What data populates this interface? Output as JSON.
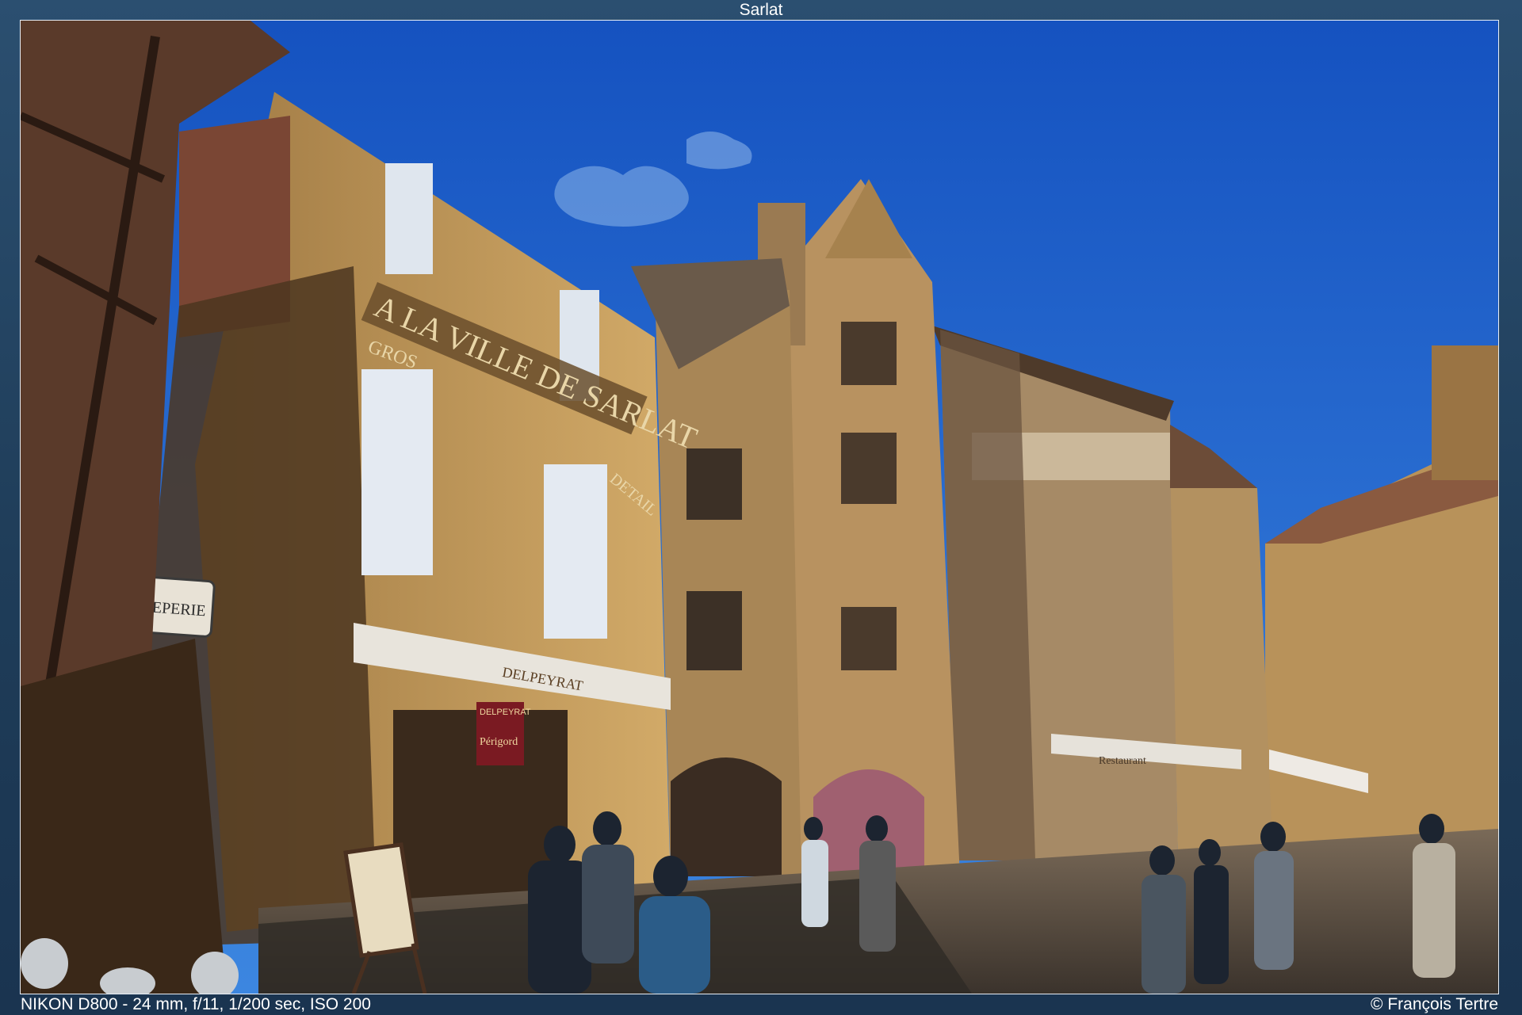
{
  "window": {
    "title": "Sarlat"
  },
  "photo": {
    "signs": {
      "main_sign": "A LA VILLE DE SARLAT",
      "gros": "GROS",
      "detail": "DETAIL",
      "creperie": "CREPERIE",
      "awning": "DELPEYRAT",
      "shop_sign_top": "DELPEYRAT",
      "shop_sign_bottom": "Périgord",
      "restaurant": "Restaurant"
    },
    "colors": {
      "sky": "#1f63c8",
      "stone_light": "#c99e5c",
      "stone_shadow": "#5c4226",
      "door": "#a06070"
    }
  },
  "footer": {
    "exif": "NIKON D800 - 24 mm, f/11, 1/200 sec, ISO 200",
    "copyright": "© François Tertre"
  }
}
